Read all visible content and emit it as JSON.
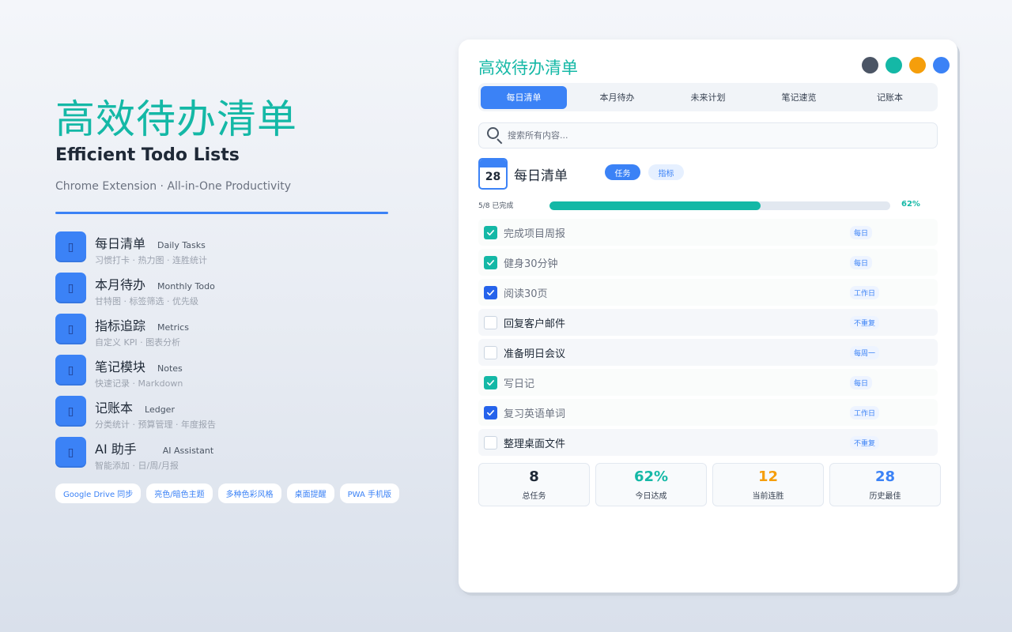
{
  "hero": {
    "title": "高效待办清单",
    "subtitle": "Efficient Todo Lists",
    "tagline": "Chrome Extension · All-in-One Productivity"
  },
  "features": [
    {
      "name": "每日清单",
      "en": "Daily Tasks",
      "desc": "习惯打卡 · 热力图 · 连胜统计",
      "icon": "calendar-icon"
    },
    {
      "name": "本月待办",
      "en": "Monthly Todo",
      "desc": "甘特图 · 标签筛选 · 优先级",
      "icon": "clipboard-icon"
    },
    {
      "name": "指标追踪",
      "en": "Metrics",
      "desc": "自定义 KPI · 图表分析",
      "icon": "chart-icon"
    },
    {
      "name": "笔记模块",
      "en": "Notes",
      "desc": "快速记录 · Markdown",
      "icon": "notes-icon"
    },
    {
      "name": "记账本",
      "en": "Ledger",
      "desc": "分类统计 · 预算管理 · 年度报告",
      "icon": "wallet-icon"
    },
    {
      "name": "AI 助手",
      "en": "AI Assistant",
      "desc": "智能添加 · 日/周/月报",
      "icon": "robot-icon"
    }
  ],
  "chips": [
    "Google Drive 同步",
    "亮色/暗色主题",
    "多种色彩风格",
    "桌面提醒",
    "PWA 手机版"
  ],
  "app": {
    "title": "高效待办清单",
    "theme_colors": [
      "#4b5565",
      "#14b8a6",
      "#f59e0b",
      "#3b82f6"
    ],
    "tabs": [
      "每日清单",
      "本月待办",
      "未来计划",
      "笔记速览",
      "记账本"
    ],
    "active_tab": 0,
    "search_placeholder": "搜索所有内容...",
    "calendar_day": "28",
    "section_title": "每日清单",
    "pills": {
      "task": "任务",
      "metric": "指标"
    },
    "progress": {
      "label": "5/8 已完成",
      "percent_text": "62%",
      "value": 0.62
    },
    "tasks": [
      {
        "text": "完成项目周报",
        "repeat": "每日",
        "done": true,
        "color": "teal"
      },
      {
        "text": "健身30分钟",
        "repeat": "每日",
        "done": true,
        "color": "teal"
      },
      {
        "text": "阅读30页",
        "repeat": "工作日",
        "done": true,
        "color": "blue"
      },
      {
        "text": "回复客户邮件",
        "repeat": "不重复",
        "done": false
      },
      {
        "text": "准备明日会议",
        "repeat": "每周一",
        "done": false
      },
      {
        "text": "写日记",
        "repeat": "每日",
        "done": true,
        "color": "teal"
      },
      {
        "text": "复习英语单词",
        "repeat": "工作日",
        "done": true,
        "color": "blue"
      },
      {
        "text": "整理桌面文件",
        "repeat": "不重复",
        "done": false
      }
    ],
    "stats": [
      {
        "value": "8",
        "label": "总任务",
        "color": "#1f2937"
      },
      {
        "value": "62%",
        "label": "今日达成",
        "color": "#14b8a6"
      },
      {
        "value": "12",
        "label": "当前连胜",
        "color": "#f59e0b"
      },
      {
        "value": "28",
        "label": "历史最佳",
        "color": "#3b82f6"
      }
    ]
  }
}
